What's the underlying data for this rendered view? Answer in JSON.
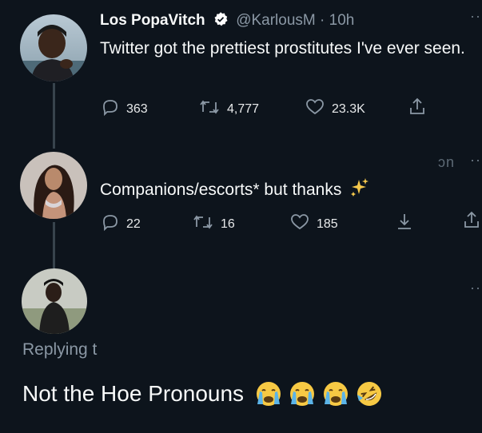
{
  "tweet1": {
    "display_name": "Los PopaVitch",
    "handle": "@KarlousM",
    "separator": "·",
    "time": "10h",
    "text": "Twitter got the prettiest prostitutes I've ever seen.",
    "replies": "363",
    "retweets": "4,777",
    "likes": "23.3K",
    "more": "··"
  },
  "tweet2": {
    "text": "Companions/escorts* but thanks",
    "replies": "22",
    "retweets": "16",
    "likes": "185",
    "time_fragment": "̶n",
    "more": "··"
  },
  "tweet3": {
    "more": "··",
    "replying_prefix": "Replying t",
    "text": "Not the Hoe Pronouns"
  },
  "colors": {
    "background": "#0d141c",
    "text": "#f7f9f9",
    "muted": "#8b98a5",
    "verified": "#ffffff"
  },
  "icons": [
    "reply-icon",
    "retweet-icon",
    "like-icon",
    "share-icon",
    "verified-badge-icon",
    "sparkles-icon",
    "crying-face-icon",
    "rofl-face-icon"
  ]
}
